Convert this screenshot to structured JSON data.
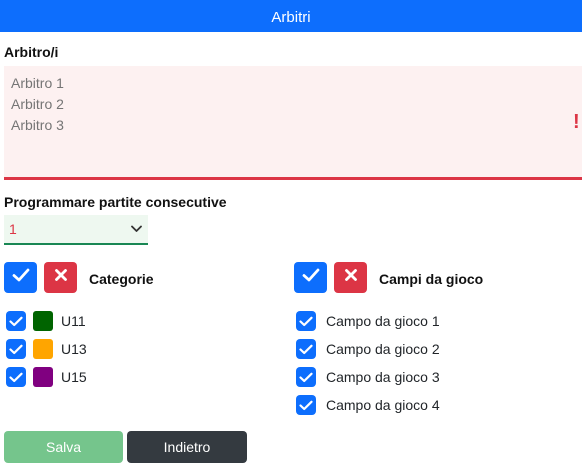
{
  "header": {
    "title": "Arbitri"
  },
  "referees": {
    "label": "Arbitro/i",
    "placeholder": "Arbitro 1\nArbitro 2\nArbitro 3",
    "error_mark": "!"
  },
  "consecutive": {
    "label": "Programmare partite consecutive",
    "selected": "1"
  },
  "categories": {
    "title": "Categorie",
    "items": [
      {
        "label": "U11",
        "color": "#006400",
        "checked": true
      },
      {
        "label": "U13",
        "color": "#FFA500",
        "checked": true
      },
      {
        "label": "U15",
        "color": "#800080",
        "checked": true
      }
    ]
  },
  "fields": {
    "title": "Campi da gioco",
    "items": [
      {
        "label": "Campo da gioco 1",
        "checked": true
      },
      {
        "label": "Campo da gioco 2",
        "checked": true
      },
      {
        "label": "Campo da gioco 3",
        "checked": true
      },
      {
        "label": "Campo da gioco 4",
        "checked": true
      }
    ]
  },
  "footer": {
    "save_label": "Salva",
    "back_label": "Indietro"
  },
  "colors": {
    "primary": "#0d6efd",
    "danger": "#dc3545",
    "success": "#198754",
    "save_disabled": "#75c58c",
    "back_dark": "#343a40"
  }
}
